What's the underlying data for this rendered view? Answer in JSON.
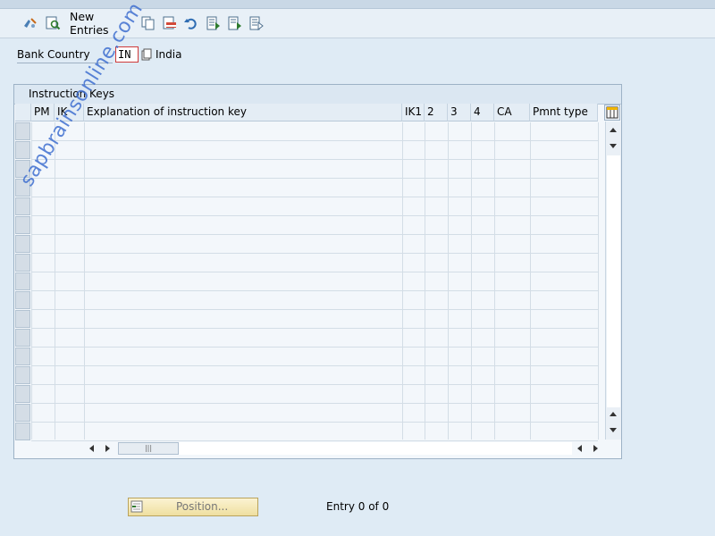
{
  "toolbar": {
    "new_entries_label": "New Entries",
    "icons": [
      "display-change-icon",
      "details-icon",
      "copy-as-icon",
      "delete-icon",
      "undo-icon",
      "select-all-icon",
      "select-block-icon",
      "deselect-all-icon"
    ]
  },
  "selection": {
    "bank_country_label": "Bank Country",
    "bank_country_value": "IN",
    "bank_country_text": "India"
  },
  "table": {
    "title": "Instruction Keys",
    "columns": [
      "PM",
      "IK",
      "Explanation of instruction key",
      "IK1",
      "2",
      "3",
      "4",
      "CA",
      "Pmnt type"
    ],
    "visible_rows": 17
  },
  "footer": {
    "position_label": "Position...",
    "entry_text": "Entry 0 of 0"
  },
  "watermark": "sapbrainsonline.com",
  "colors": {
    "background": "#dfebf5",
    "required_field_border": "#cf3a3a",
    "position_button": "#f3e6b0",
    "watermark": "#3f6fd0"
  }
}
